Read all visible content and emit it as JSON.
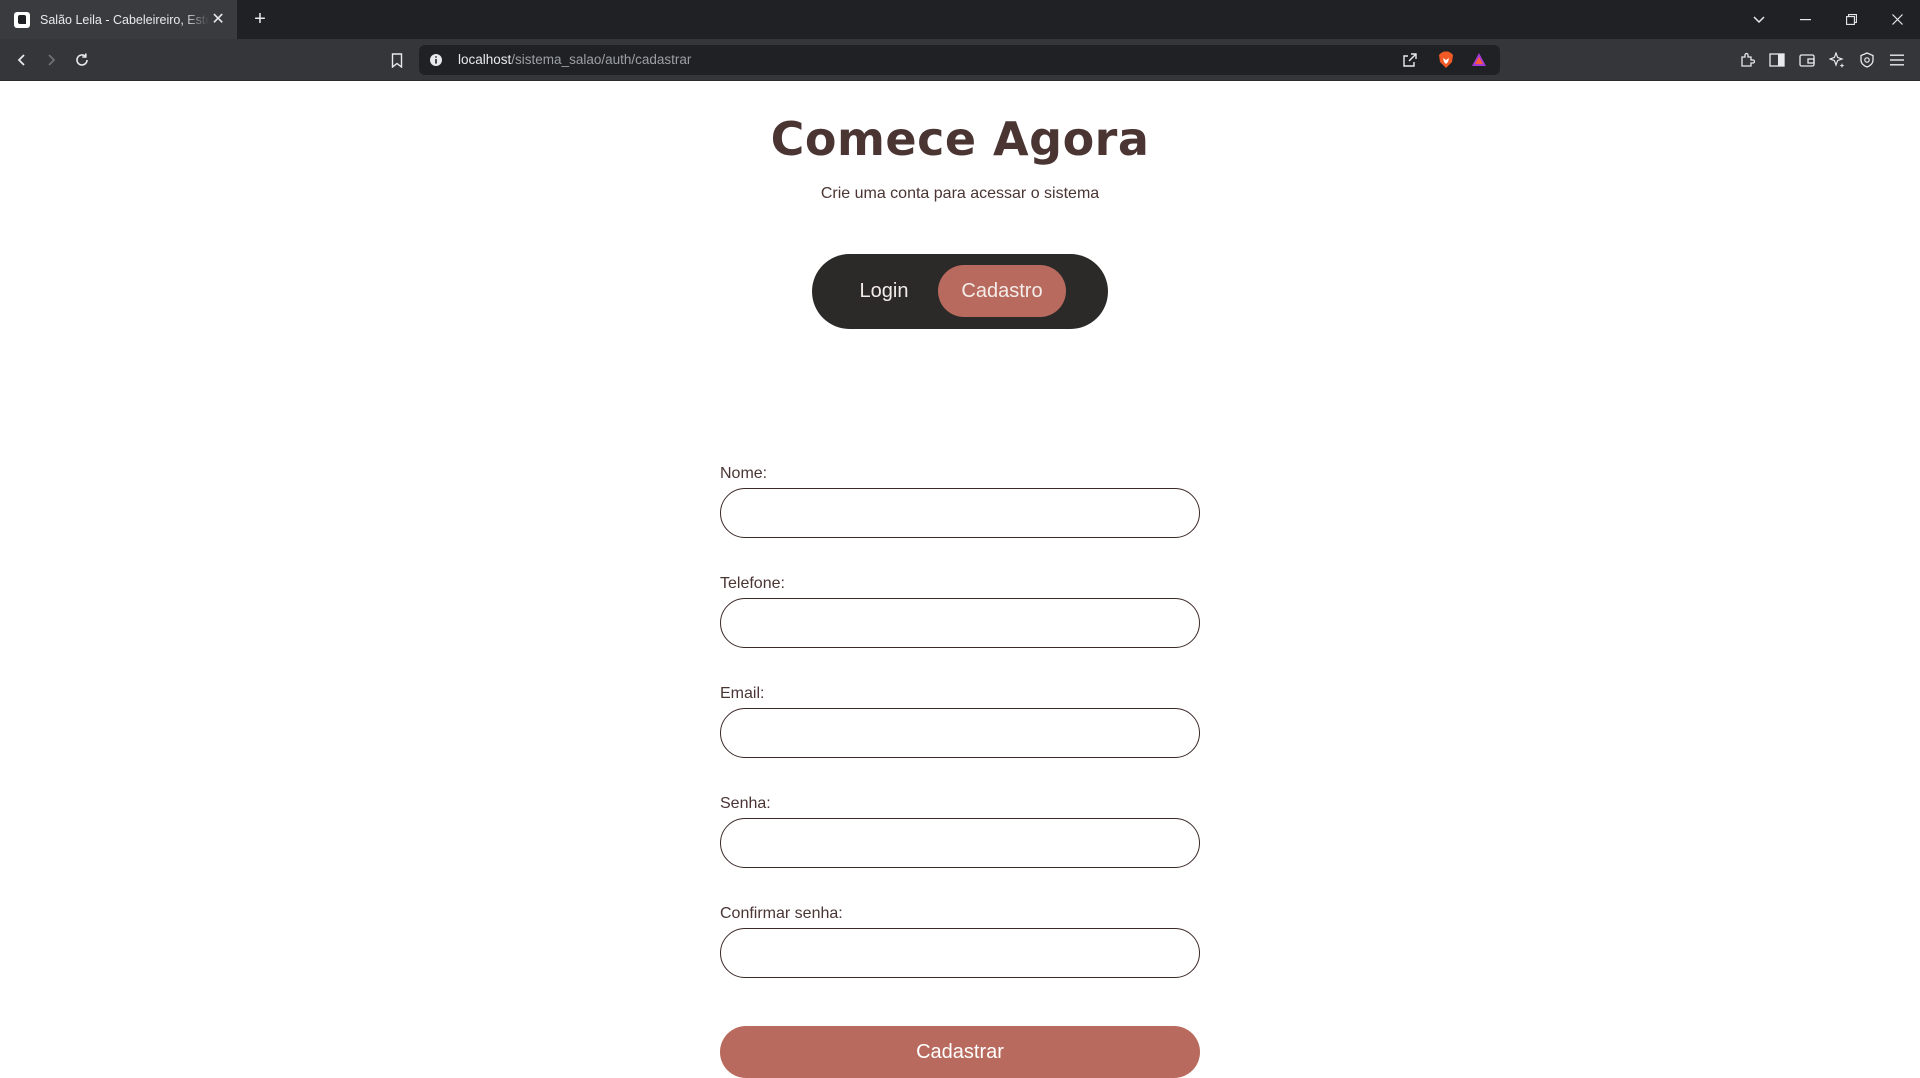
{
  "browser": {
    "tab_title": "Salão Leila - Cabeleireiro, Estética",
    "new_tab_symbol": "+",
    "close_symbol": "✕",
    "url_host": "localhost",
    "url_path": "/sistema_salao/auth/cadastrar"
  },
  "header": {
    "title": "Comece Agora",
    "subtitle": "Crie uma conta para acessar o sistema"
  },
  "mode_toggle": {
    "login_label": "Login",
    "signup_label": "Cadastro",
    "selected": "Cadastro"
  },
  "form": {
    "fields": [
      {
        "label": "Nome:",
        "value": ""
      },
      {
        "label": "Telefone:",
        "value": ""
      },
      {
        "label": "Email:",
        "value": ""
      },
      {
        "label": "Senha:",
        "value": ""
      },
      {
        "label": "Confirmar senha:",
        "value": ""
      }
    ],
    "submit_label": "Cadastrar"
  },
  "colors": {
    "accent": "#b86a5e",
    "dark": "#2b2a29",
    "text": "#4a3533"
  }
}
